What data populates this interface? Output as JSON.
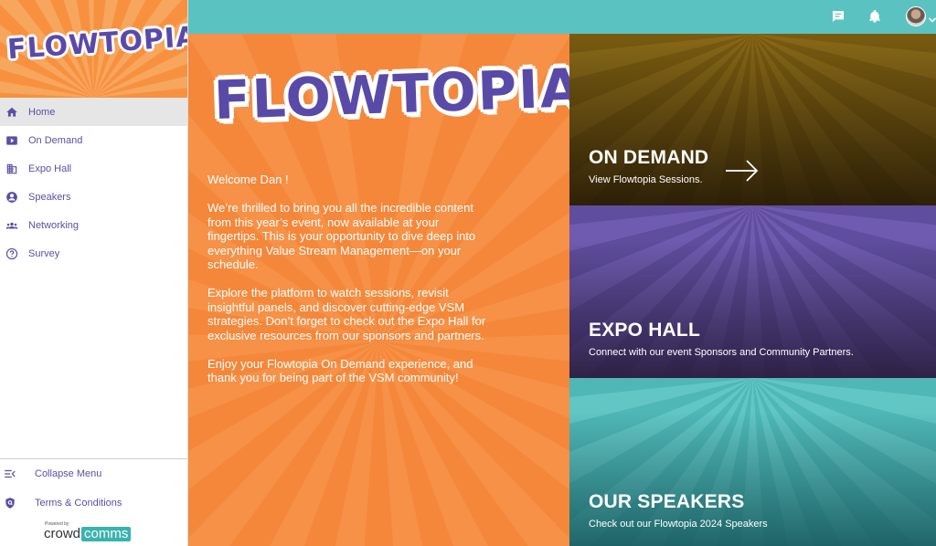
{
  "brand": {
    "logo_text": "FLOWTOPIA",
    "accent": "#5b4ea6",
    "orange": "#f5873a",
    "teal": "#5bc2c2"
  },
  "sidebar": {
    "items": [
      {
        "label": "Home",
        "icon": "home-icon",
        "active": true
      },
      {
        "label": "On Demand",
        "icon": "play-video-icon"
      },
      {
        "label": "Expo Hall",
        "icon": "building-icon"
      },
      {
        "label": "Speakers",
        "icon": "person-circle-icon"
      },
      {
        "label": "Networking",
        "icon": "group-icon"
      },
      {
        "label": "Survey",
        "icon": "help-circle-icon"
      }
    ],
    "collapse_label": "Collapse Menu",
    "terms_label": "Terms & Conditions",
    "powered_by": "Powered by",
    "provider_left": "crowd",
    "provider_right": "comms"
  },
  "topbar": {
    "icons": [
      "chat-icon",
      "bell-icon",
      "user-avatar",
      "chevron-down-icon"
    ]
  },
  "hero": {
    "logo_text": "FLOWTOPIA",
    "greeting": "Welcome Dan !",
    "paragraph1": "We’re thrilled to bring you all the incredible content from this year’s event, now available at your fingertips. This is your opportunity to dive deep into everything Value Stream Management—on your schedule.",
    "paragraph2": "Explore the platform to watch sessions, revisit insightful panels, and discover cutting-edge VSM strategies. Don’t forget to check out the Expo Hall for exclusive resources from our sponsors and partners.",
    "paragraph3": "Enjoy your Flowtopia On Demand experience, and thank you for being part of the VSM community!"
  },
  "cards": {
    "on_demand": {
      "title": "ON DEMAND",
      "subtitle": "View Flowtopia Sessions."
    },
    "expo_hall": {
      "title": "EXPO HALL",
      "subtitle": "Connect with our event Sponsors and Community Partners."
    },
    "speakers": {
      "title": "OUR SPEAKERS",
      "subtitle": "Check out our Flowtopia 2024 Speakers"
    }
  }
}
